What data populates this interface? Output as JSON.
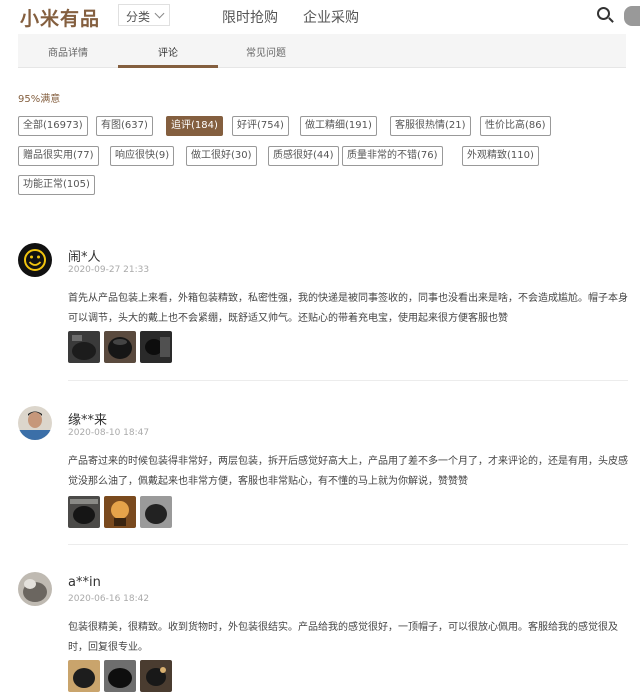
{
  "header": {
    "logo": "小米有品",
    "category_label": "分类",
    "nav": [
      "限时抢购",
      "企业采购"
    ]
  },
  "tabs": [
    "商品详情",
    "评论",
    "常见问题"
  ],
  "satisfaction": "95%满意",
  "tags": [
    {
      "label": "全部(16973)",
      "active": false
    },
    {
      "label": "有图(637)",
      "active": false
    },
    {
      "label": "追评(184)",
      "active": true
    },
    {
      "label": "好评(754)",
      "active": false
    },
    {
      "label": "做工精细(191)",
      "active": false
    },
    {
      "label": "客服很热情(21)",
      "active": false
    },
    {
      "label": "性价比高(86)",
      "active": false
    },
    {
      "label": "赠品很实用(77)",
      "active": false
    },
    {
      "label": "响应很快(9)",
      "active": false
    },
    {
      "label": "做工很好(30)",
      "active": false
    },
    {
      "label": "质感很好(44)",
      "active": false
    },
    {
      "label": "质量非常的不错(76)",
      "active": false
    },
    {
      "label": "外观精致(110)",
      "active": false
    },
    {
      "label": "功能正常(105)",
      "active": false
    }
  ],
  "reviews": [
    {
      "name": "闹*人",
      "date": "2020-09-27 21:33",
      "text": "首先从产品包装上来看，外箱包装精致，私密性强，我的快递是被同事签收的，同事也没看出来是啥，不会造成尴尬。帽子本身可以调节，头大的戴上也不会紧绷，既舒适又帅气。还贴心的带着充电宝，使用起来很方便客服也赞"
    },
    {
      "name": "缘**来",
      "date": "2020-08-10 18:47",
      "text": "产品寄过来的时候包装得非常好，两层包装，拆开后感觉好高大上，产品用了差不多一个月了，才来评论的，还是有用，头皮感觉没那么油了，佩戴起来也非常方便，客服也非常贴心，有不懂的马上就为你解说，赞赞赞"
    },
    {
      "name": "a**in",
      "date": "2020-06-16 18:42",
      "text": "包装很精美，很精致。收到货物时，外包装很结实。产品给我的感觉很好，一顶帽子，可以很放心佩用。客服给我的感觉很及时，回复很专业。"
    }
  ]
}
